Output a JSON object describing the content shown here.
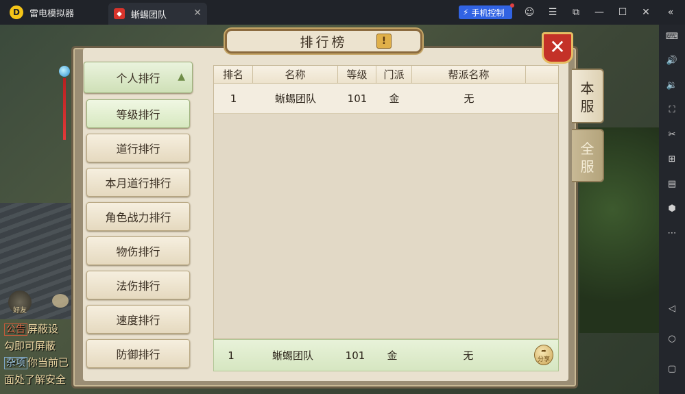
{
  "titlebar": {
    "app_name": "雷电模拟器",
    "tab_label": "蜥蜴团队",
    "control_label": "手机控制",
    "icons": [
      "logo-icon",
      "game-tab-icon",
      "tab-close-icon",
      "bolt-icon",
      "user-icon",
      "menu-icon",
      "restore-window-icon",
      "minimize-icon",
      "maximize-icon",
      "close-icon",
      "collapse-icon"
    ]
  },
  "sidebar": {
    "icons": [
      "keyboard-icon",
      "volume-up-icon",
      "volume-down-icon",
      "screenshot-icon",
      "scissors-icon",
      "add-window-icon",
      "apk-install-icon",
      "settings-hex-icon",
      "more-icon",
      "back-icon",
      "home-icon",
      "recents-icon"
    ]
  },
  "chat": {
    "friend_label": "好友",
    "lines": [
      {
        "tag": "公告",
        "text": "屏蔽设"
      },
      {
        "tag": "",
        "text": "勾即可屏蔽"
      },
      {
        "tag": "杂项",
        "text": "你当前已"
      },
      {
        "tag": "",
        "text": "面处了解安全"
      }
    ]
  },
  "panel": {
    "title": "排行榜",
    "help_label": "!",
    "close_label": "✕",
    "menu": {
      "header": "个人排行",
      "items": [
        "等级排行",
        "道行排行",
        "本月道行排行",
        "角色战力排行",
        "物伤排行",
        "法伤排行",
        "速度排行",
        "防御排行"
      ],
      "active_index": 0
    },
    "table": {
      "columns": [
        "排名",
        "名称",
        "等级",
        "门派",
        "帮派名称"
      ],
      "rows": [
        {
          "rank": "1",
          "name": "蜥蜴团队",
          "level": "101",
          "sect": "金",
          "guild": "无"
        }
      ]
    },
    "my_rank": {
      "rank": "1",
      "name": "蜥蜴团队",
      "level": "101",
      "sect": "金",
      "guild": "无",
      "share_label": "分享"
    },
    "side_tabs": [
      {
        "label": "本服",
        "active": true
      },
      {
        "label": "全服",
        "active": false
      }
    ]
  },
  "colors": {
    "accent_blue": "#3163e3",
    "close_red": "#c43128",
    "highlight_green": "#d6e6c1"
  }
}
